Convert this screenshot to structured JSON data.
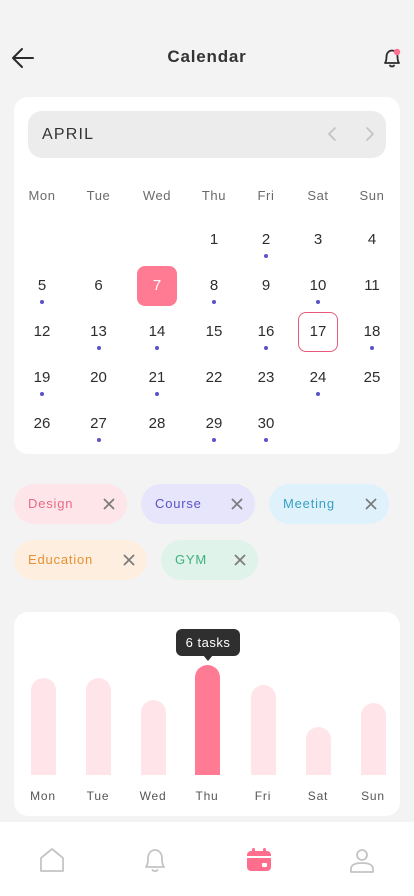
{
  "header": {
    "title": "Calendar",
    "back_icon": "arrow-left-icon",
    "notification_icon": "bell-icon",
    "notification_badge_color": "#ff6f8d"
  },
  "calendar": {
    "month": "APRIL",
    "weekdays": [
      "Mon",
      "Tue",
      "Wed",
      "Thu",
      "Fri",
      "Sat",
      "Sun"
    ],
    "weeks": [
      [
        "",
        "",
        "",
        "1",
        "2",
        "3",
        "4"
      ],
      [
        "5",
        "6",
        "7",
        "8",
        "9",
        "10",
        "11"
      ],
      [
        "12",
        "13",
        "14",
        "15",
        "16",
        "17",
        "18"
      ],
      [
        "19",
        "20",
        "21",
        "22",
        "23",
        "24",
        "25"
      ],
      [
        "26",
        "27",
        "28",
        "29",
        "30",
        "",
        ""
      ]
    ],
    "days_with_events": [
      "2",
      "5",
      "8",
      "10",
      "13",
      "14",
      "16",
      "18",
      "19",
      "21",
      "24",
      "27",
      "29",
      "30"
    ],
    "selected_day": "7",
    "today": "17",
    "accent_color": "#ff7a93",
    "event_dot_color": "#5a52c8"
  },
  "filters": [
    {
      "label": "Design",
      "bg": "#fde5ea",
      "fg": "#e86a86"
    },
    {
      "label": "Course",
      "bg": "#e6e5fb",
      "fg": "#5a52c8"
    },
    {
      "label": "Meeting",
      "bg": "#dff2fb",
      "fg": "#3a9fc4"
    },
    {
      "label": "Education",
      "bg": "#fdeee0",
      "fg": "#e5912f"
    },
    {
      "label": "GYM",
      "bg": "#dff3ea",
      "fg": "#3fb080"
    }
  ],
  "chart_data": {
    "type": "bar",
    "categories": [
      "Mon",
      "Tue",
      "Wed",
      "Thu",
      "Fri",
      "Sat",
      "Sun"
    ],
    "values": [
      5.3,
      5.3,
      4.1,
      6,
      4.9,
      2.6,
      3.9
    ],
    "highlighted": "Thu",
    "tooltip": "6 tasks",
    "ylim": [
      0,
      6
    ],
    "bar_color": "#ffe4e9",
    "highlight_color": "#ff7a93"
  },
  "tabbar": {
    "items": [
      {
        "icon": "home-icon",
        "active": false
      },
      {
        "icon": "bell-icon",
        "active": false
      },
      {
        "icon": "calendar-icon",
        "active": true
      },
      {
        "icon": "profile-icon",
        "active": false
      }
    ]
  }
}
